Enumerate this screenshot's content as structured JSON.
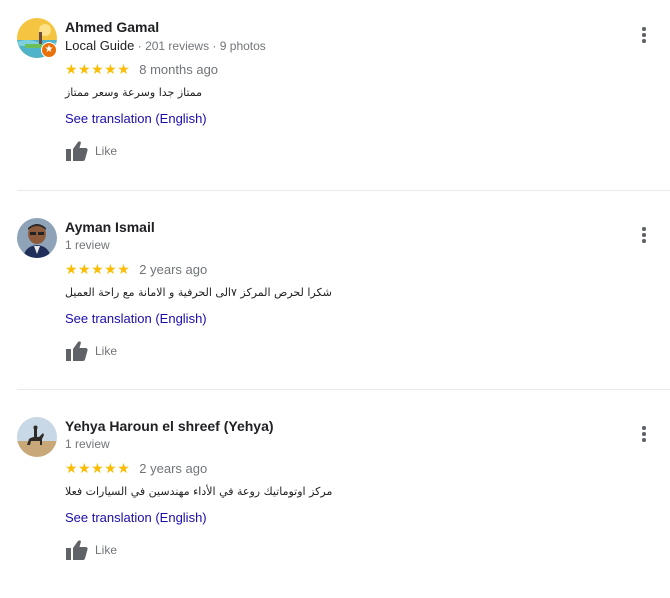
{
  "reviews": [
    {
      "name": "Ahmed Gamal",
      "local_guide": "Local Guide",
      "meta_separator": " · ",
      "meta_stats": "201 reviews · 9 photos",
      "stars": "★★★★★",
      "rating": 5,
      "date": "8 months ago",
      "text": "ممتاز جدا وسرعة وسعر ممتاز",
      "translate_label": "See translation (English)",
      "like_label": "Like",
      "avatar_icon": "landscape-avatar-icon",
      "badge_icon": "local-guide-star-icon"
    },
    {
      "name": "Ayman Ismail",
      "meta_stats": "1 review",
      "stars": "★★★★★",
      "rating": 5,
      "date": "2 years ago",
      "text": "شكرا لحرص المركز ٧الى الحرفية و الامانة مع راحة العميل",
      "translate_label": "See translation (English)",
      "like_label": "Like",
      "avatar_icon": "portrait-avatar-icon"
    },
    {
      "name": "Yehya Haroun el shreef (Yehya)",
      "meta_stats": "1 review",
      "stars": "★★★★★",
      "rating": 5,
      "date": "2 years ago",
      "text": "مركز اوتوماتيك روعة في الأداء مهندسين في السيارات فعلا",
      "translate_label": "See translation (English)",
      "like_label": "Like",
      "avatar_icon": "horse-rider-avatar-icon"
    }
  ],
  "colors": {
    "star": "#fbbc04",
    "link": "#1a0dab",
    "secondary_text": "#70757a",
    "badge": "#e8710a",
    "divider": "#e8eaed"
  }
}
